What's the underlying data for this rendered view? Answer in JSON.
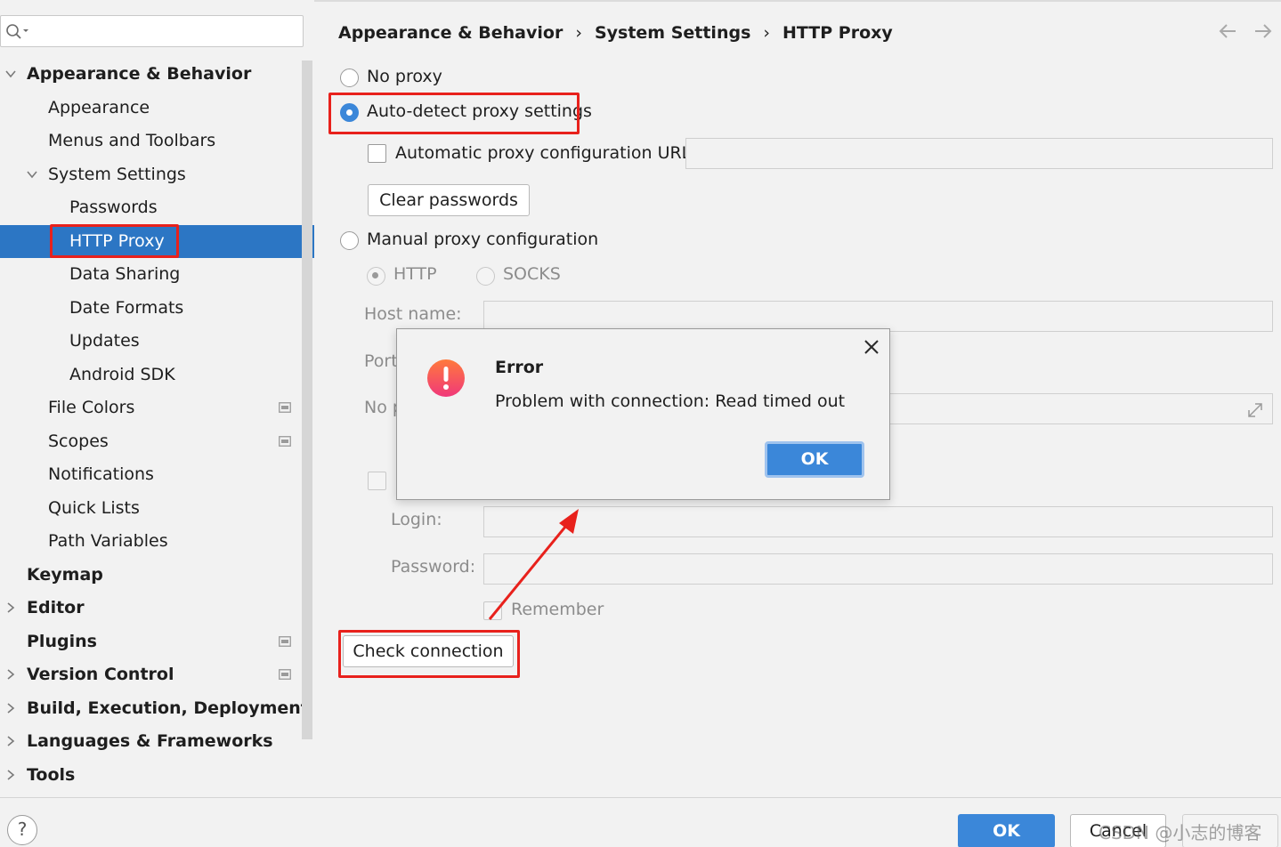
{
  "search": {
    "placeholder": ""
  },
  "sidebar": {
    "items": [
      {
        "label": "Appearance & Behavior",
        "bold": true,
        "expanded": true
      },
      {
        "label": "Appearance"
      },
      {
        "label": "Menus and Toolbars"
      },
      {
        "label": "System Settings",
        "expanded": true
      },
      {
        "label": "Passwords"
      },
      {
        "label": "HTTP Proxy",
        "selected": true
      },
      {
        "label": "Data Sharing"
      },
      {
        "label": "Date Formats"
      },
      {
        "label": "Updates"
      },
      {
        "label": "Android SDK"
      },
      {
        "label": "File Colors",
        "project_icon": true
      },
      {
        "label": "Scopes",
        "project_icon": true
      },
      {
        "label": "Notifications"
      },
      {
        "label": "Quick Lists"
      },
      {
        "label": "Path Variables"
      },
      {
        "label": "Keymap",
        "bold": true
      },
      {
        "label": "Editor",
        "bold": true,
        "collapsed": true
      },
      {
        "label": "Plugins",
        "bold": true,
        "project_icon": true
      },
      {
        "label": "Version Control",
        "bold": true,
        "collapsed": true,
        "project_icon": true
      },
      {
        "label": "Build, Execution, Deployment",
        "bold": true,
        "collapsed": true
      },
      {
        "label": "Languages & Frameworks",
        "bold": true,
        "collapsed": true
      },
      {
        "label": "Tools",
        "bold": true,
        "collapsed": true
      }
    ]
  },
  "breadcrumb": {
    "items": [
      "Appearance & Behavior",
      "System Settings",
      "HTTP Proxy"
    ],
    "separator": "›"
  },
  "proxy": {
    "no_proxy_label": "No proxy",
    "auto_detect_label": "Auto-detect proxy settings",
    "auto_config_url_label": "Automatic proxy configuration URL:",
    "auto_config_url_value": "",
    "clear_passwords_label": "Clear passwords",
    "manual_label": "Manual proxy configuration",
    "http_label": "HTTP",
    "socks_label": "SOCKS",
    "host_label": "Host name:",
    "port_label": "Port",
    "no_proxy_for_label": "No p",
    "login_label": "Login:",
    "password_label": "Password:",
    "remember_label": "Remember",
    "check_connection_label": "Check connection",
    "selected_mode": "auto-detect"
  },
  "dialog": {
    "title": "Error",
    "message": "Problem with connection: Read timed out",
    "ok_label": "OK"
  },
  "footer": {
    "help_label": "?",
    "ok_label": "OK",
    "cancel_label": "Cancel",
    "watermark": "CSDN @小志的博客"
  },
  "colors": {
    "selection": "#2c76c4",
    "accent": "#3b87d9",
    "highlight": "#e8211c",
    "background": "#f2f2f2"
  }
}
